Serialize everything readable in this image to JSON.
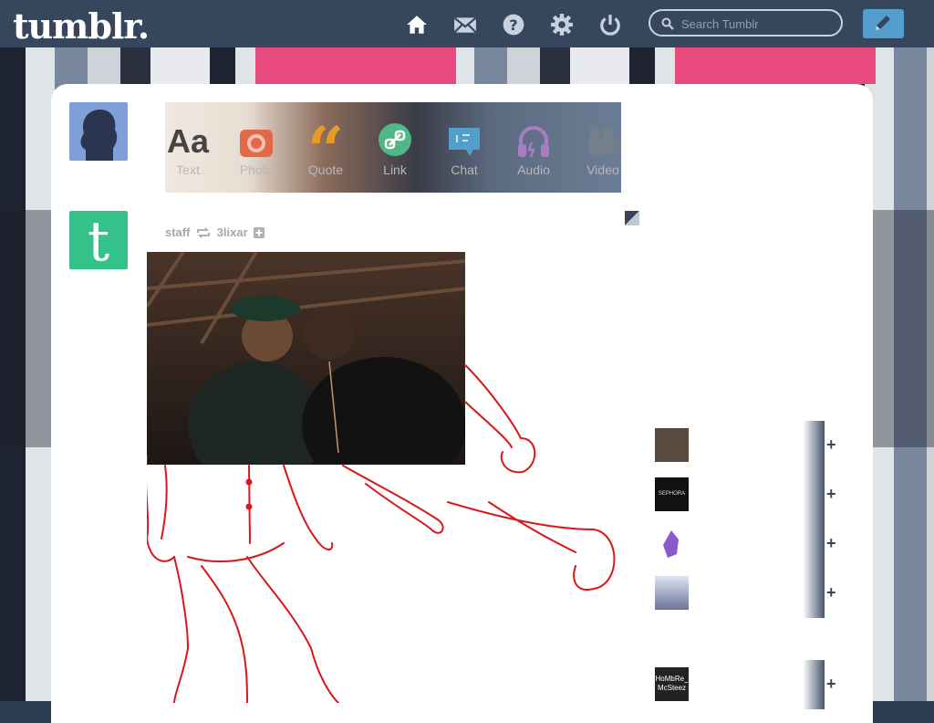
{
  "header": {
    "logo": "tumblr.",
    "nav": [
      {
        "icon": "home-icon"
      },
      {
        "icon": "mail-icon"
      },
      {
        "icon": "help-icon"
      },
      {
        "icon": "gear-icon"
      },
      {
        "icon": "power-icon"
      }
    ],
    "search_placeholder": "Search Tumblr",
    "compose_icon": "pencil-icon"
  },
  "post_types": [
    {
      "label": "Text",
      "glyph": "Aa",
      "color": "#444444"
    },
    {
      "label": "Photo",
      "icon": "camera-icon",
      "color": "#e06a48"
    },
    {
      "label": "Quote",
      "glyph": "“",
      "color": "#e8992b"
    },
    {
      "label": "Link",
      "icon": "link-icon",
      "color": "#4fb886"
    },
    {
      "label": "Chat",
      "icon": "chat-icon",
      "color": "#529ecc"
    },
    {
      "label": "Audio",
      "icon": "headphones-icon",
      "color": "#a77dc2"
    },
    {
      "label": "Video",
      "icon": "video-icon",
      "color": "#748089"
    }
  ],
  "post": {
    "author": "staff",
    "reblogged_from": "3lixar",
    "follow_icon": "plus-icon"
  },
  "recommended": [
    {
      "avatar_color": "#5a4a3e"
    },
    {
      "avatar_color": "#111111",
      "avatar_text": "SEPHORA"
    },
    {
      "avatar_color": "#8b59c9"
    },
    {
      "avatar_color": "#8a94b8"
    },
    {
      "avatar_color": "#222222",
      "avatar_text": "HoMbRe_McSteez"
    }
  ],
  "follow_symbol": "+",
  "colors": {
    "header_bg": "#36465d",
    "accent": "#529ecc",
    "staff_green": "#35c28a"
  }
}
